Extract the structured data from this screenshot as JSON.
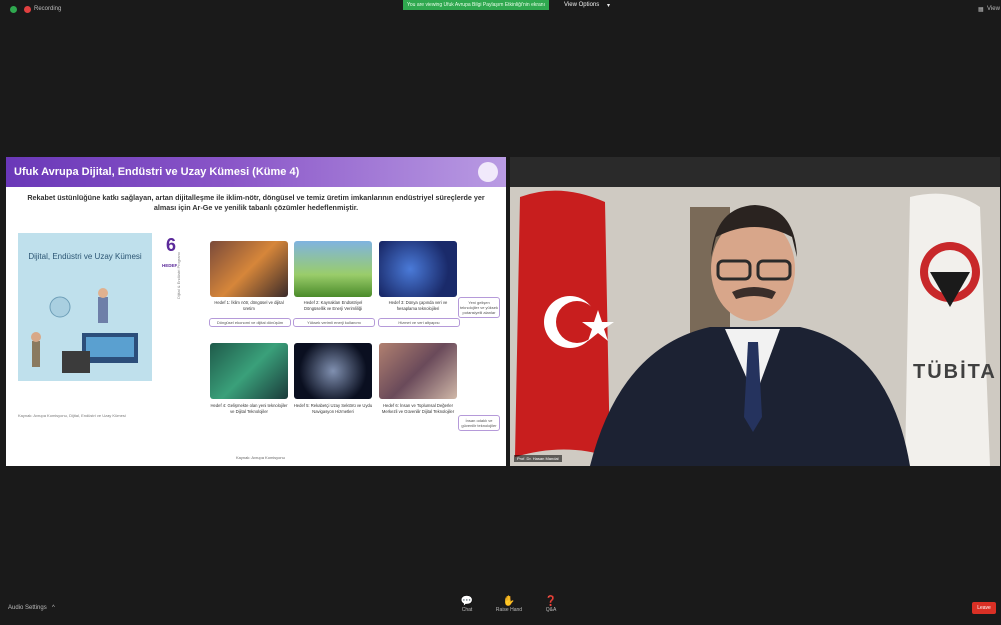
{
  "topbar": {
    "recording_label": "Recording",
    "share_banner": "You are viewing Ufuk Avrupa Bilgi Paylaşım Etkinliği'nin ekranı",
    "view_options": "View Options",
    "view_label": "View"
  },
  "slide": {
    "title": "Ufuk Avrupa Dijital, Endüstri ve Uzay Kümesi (Küme 4)",
    "subtitle": "Rekabet üstünlüğüne katkı sağlayan, artan dijitalleşme ile iklim-nötr, döngüsel ve temiz üretim imkanlarının endüstriyel süreçlerde yer alması için Ar-Ge ve yenilik tabanlı çözümler hedeflenmiştir.",
    "panel_title": "Dijital, Endüstri ve Uzay Kümesi",
    "left_note": "Kaynak: Avrupa Komisyonu, Dijital, Endüstri ve Uzay Kümesi",
    "count": "6",
    "count_label": "HEDEF",
    "vertical_label": "Dijital & Endüstri Programı",
    "tiles": [
      {
        "caption": "Hedef 1: İklim nötr, döngüsel ve dijital üretim"
      },
      {
        "caption": "Hedef 2: Kaynakları Endüstriyel Döngüsellik ve Enerji Verimliliği"
      },
      {
        "caption": "Hedef 3: Dünya çapında veri ve hesaplama teknolojileri"
      },
      {
        "caption": "Hedef 4: Gelişmekte olan yeni teknolojiler ve Dijital Teknolojiler"
      },
      {
        "caption": "Hedef 5: Rekabetçi Uzay Sektörü ve Uydu Navigasyon Hizmetleri"
      },
      {
        "caption": "Hedef 6: İnsan ve Toplumsal Değerler Merkezli ve Güvenilir Dijital Teknolojiler"
      }
    ],
    "notes": [
      "Döngüsel ekonomi ve dijital dönüşüm",
      "Yüksek verimli enerji kullanımı",
      "Hizmet ve veri altyapısı"
    ],
    "side_notes": [
      "Yeni gelişen teknolojiler ve yüksek potansiyelli alanlar",
      "İnsan odaklı ve güvenilir teknolojiler"
    ],
    "bottom_note": "Kaynak: Avrupa Komisyonu"
  },
  "video": {
    "participant_name": "Prof. Dr. Hasan Mandal",
    "logo_text": "TÜBİTA"
  },
  "bottombar": {
    "audio_settings": "Audio Settings",
    "controls": [
      {
        "label": "Chat",
        "icon": "chat-icon"
      },
      {
        "label": "Raise Hand",
        "icon": "raise-hand-icon"
      },
      {
        "label": "Q&A",
        "icon": "qa-icon"
      }
    ],
    "leave_label": "Leave"
  },
  "colors": {
    "accent": "#6a38b8",
    "banner": "#2fa84f",
    "leave": "#d93025"
  }
}
